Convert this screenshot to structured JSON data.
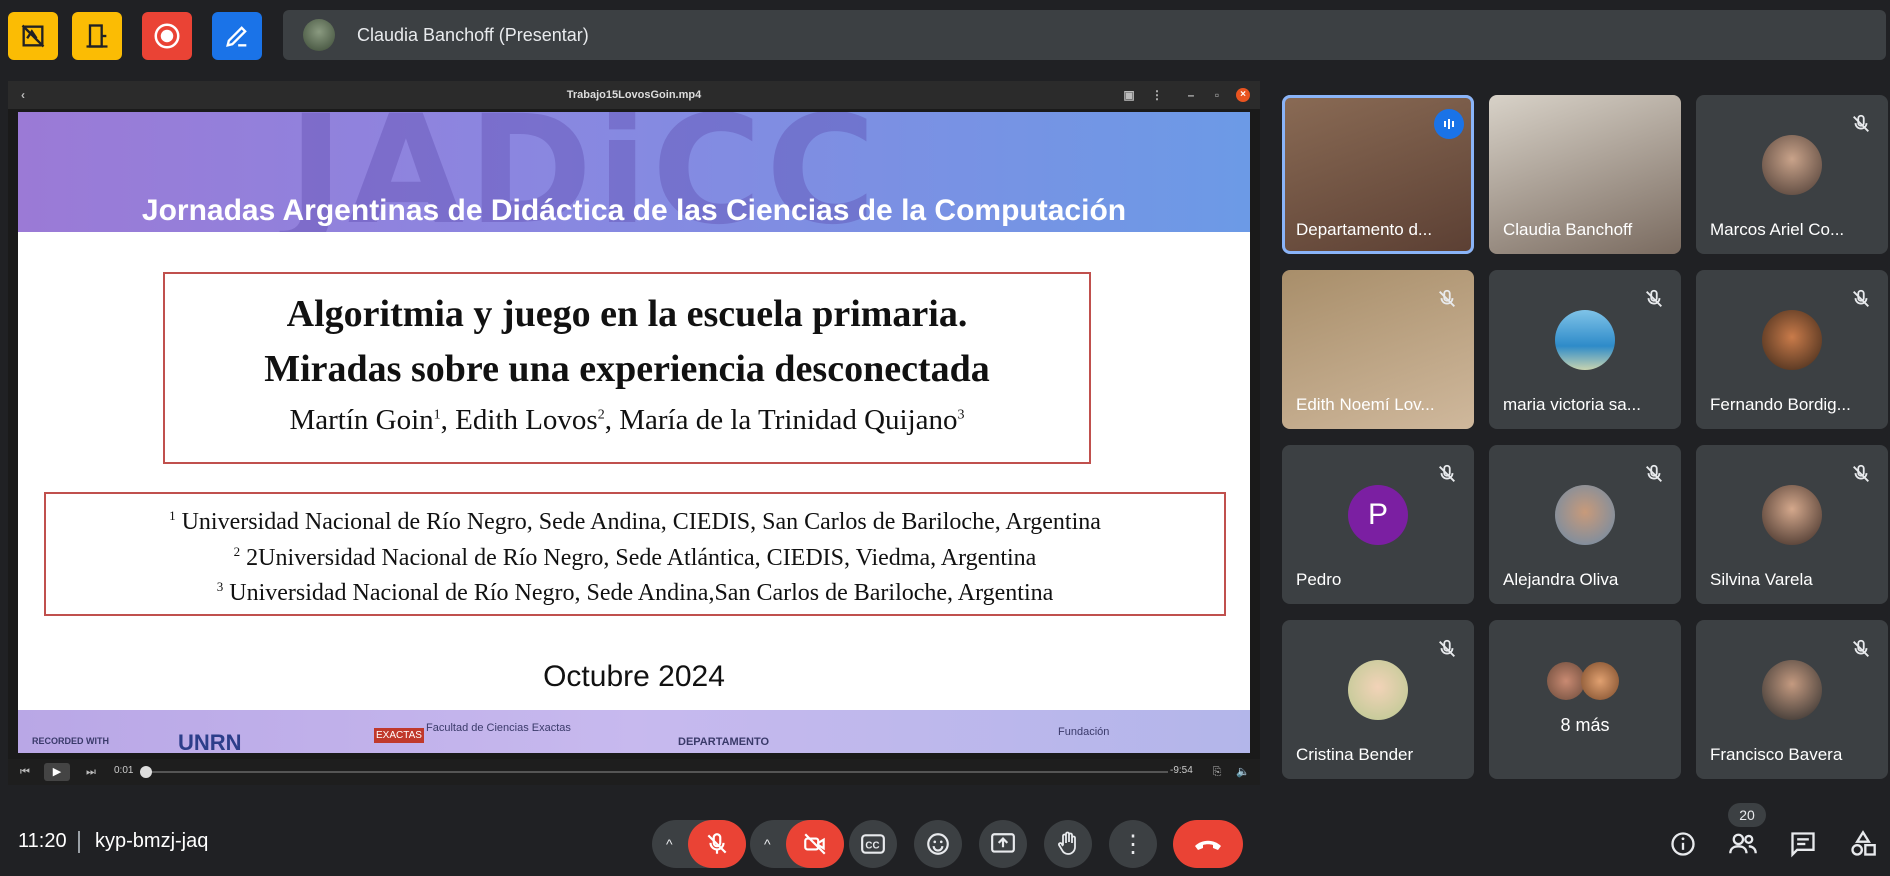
{
  "presenter": {
    "name": "Claudia Banchoff (Presentar)"
  },
  "video": {
    "filename": "Trabajo15LovosGoin.mp4",
    "current_time": "0:01",
    "remaining_time": "-9:54",
    "progress": 0.002
  },
  "slide": {
    "watermark": "JADiCC",
    "banner": "Jornadas Argentinas de Didáctica de las Ciencias de la Computación",
    "title_line1": "Algoritmia y juego en la escuela primaria.",
    "title_line2": "Miradas sobre una experiencia desconectada",
    "authors": [
      {
        "name": "Martín Goin",
        "sup": "1"
      },
      {
        "name": "Edith Lovos",
        "sup": "2"
      },
      {
        "name": "María de la Trinidad Quijano",
        "sup": "3"
      }
    ],
    "affiliations": [
      {
        "sup": "1",
        "text": "Universidad Nacional de Río Negro, Sede Andina, CIEDIS, San Carlos de Bariloche, Argentina"
      },
      {
        "sup": "2",
        "text": "2Universidad Nacional de Río Negro, Sede Atlántica, CIEDIS, Viedma, Argentina"
      },
      {
        "sup": "3",
        "text": "Universidad Nacional de Río Negro, Sede Andina,San Carlos de Bariloche, Argentina"
      }
    ],
    "date": "Octubre 2024",
    "logos": {
      "recorded": "RECORDED WITH",
      "unrn": "UNRN",
      "exactas": "EXACTAS",
      "facultad": "Facultad de Ciencias Exactas",
      "departamento": "DEPARTAMENTO",
      "fundacion": "Fundación"
    }
  },
  "participants": [
    {
      "name": "Departamento d...",
      "speaking": true
    },
    {
      "name": "Claudia Banchoff",
      "muted": false
    },
    {
      "name": "Marcos Ariel Co...",
      "muted": true
    },
    {
      "name": "Edith Noemí Lov...",
      "muted": true
    },
    {
      "name": "maria victoria sa...",
      "muted": true
    },
    {
      "name": "Fernando Bordig...",
      "muted": true
    },
    {
      "name": "Pedro",
      "initial": "P",
      "muted": true
    },
    {
      "name": "Alejandra Oliva",
      "muted": true
    },
    {
      "name": "Silvina Varela",
      "muted": true
    },
    {
      "name": "Cristina Bender",
      "muted": true
    },
    {
      "name": "8 más"
    },
    {
      "name": "Francisco Bavera",
      "muted": true
    }
  ],
  "meeting": {
    "time": "11:20",
    "code": "kyp-bmzj-jaq",
    "participant_count": "20"
  },
  "colors": {
    "red": "#ea4335",
    "yellow": "#fbbc04",
    "blue": "#1a73e8",
    "accent_border": "#8ab4f8"
  }
}
